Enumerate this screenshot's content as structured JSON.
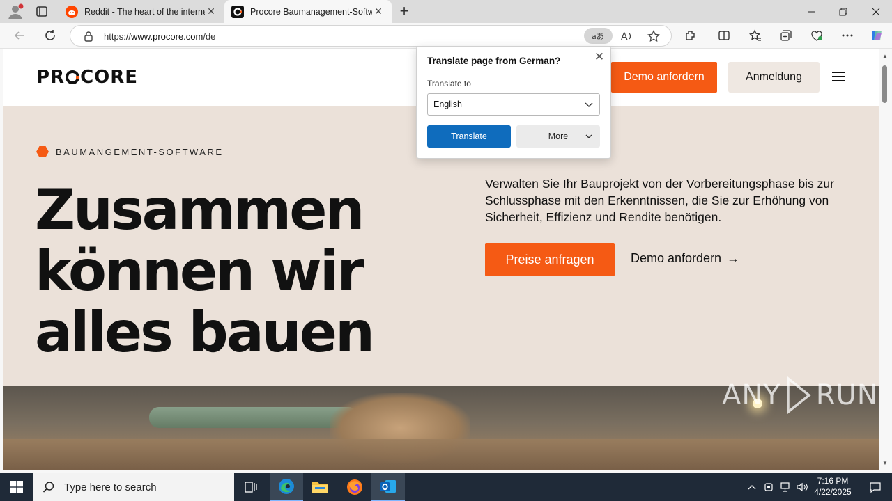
{
  "browser": {
    "tabs": [
      {
        "title": "Reddit - The heart of the internet",
        "favicon": "reddit-icon",
        "active": false
      },
      {
        "title": "Procore Baumanagement-Software",
        "favicon": "procore-icon",
        "active": true
      }
    ],
    "address": {
      "url_prefix": "https://",
      "url_host": "www.procore.com",
      "url_path": "/de"
    },
    "toolbar_icons": [
      "back-icon",
      "refresh-icon",
      "translate-icon",
      "read-aloud-icon",
      "favorite-star-icon",
      "extensions-icon",
      "split-screen-icon",
      "favorites-icon",
      "collections-icon",
      "browser-essentials-icon",
      "more-icon",
      "copilot-icon"
    ]
  },
  "translate_popup": {
    "title": "Translate page from  German?",
    "label": "Translate to",
    "language": "English",
    "translate_label": "Translate",
    "more_label": "More"
  },
  "site": {
    "logo": {
      "before": "PR",
      "after": "CORE"
    },
    "header": {
      "demo_label": "Demo anfordern",
      "login_label": "Anmeldung"
    },
    "hero": {
      "eyebrow": "BAUMANGEMENT-SOFTWARE",
      "title_line1": "Zusammen",
      "title_line2": "können wir",
      "title_line3": "alles bauen",
      "text": "Verwalten Sie Ihr Bauprojekt von der Vorbereitungsphase bis zur Schlussphase mit den Erkenntnissen, die Sie zur Erhöhung von Sicherheit, Effizienz und Rendite benötigen.",
      "prices_label": "Preise anfragen",
      "demo_link_label": "Demo anfordern",
      "demo_link_arrow": "→"
    },
    "watermark": {
      "left": "ANY",
      "right": "RUN"
    }
  },
  "taskbar": {
    "search_placeholder": "Type here to search",
    "time": "7:16 PM",
    "date": "4/22/2025"
  },
  "colors": {
    "brand_orange": "#f55a14",
    "hero_bg": "#ebe1d9",
    "edge_blue": "#0f6cbd",
    "taskbar": "#1f2a38"
  }
}
